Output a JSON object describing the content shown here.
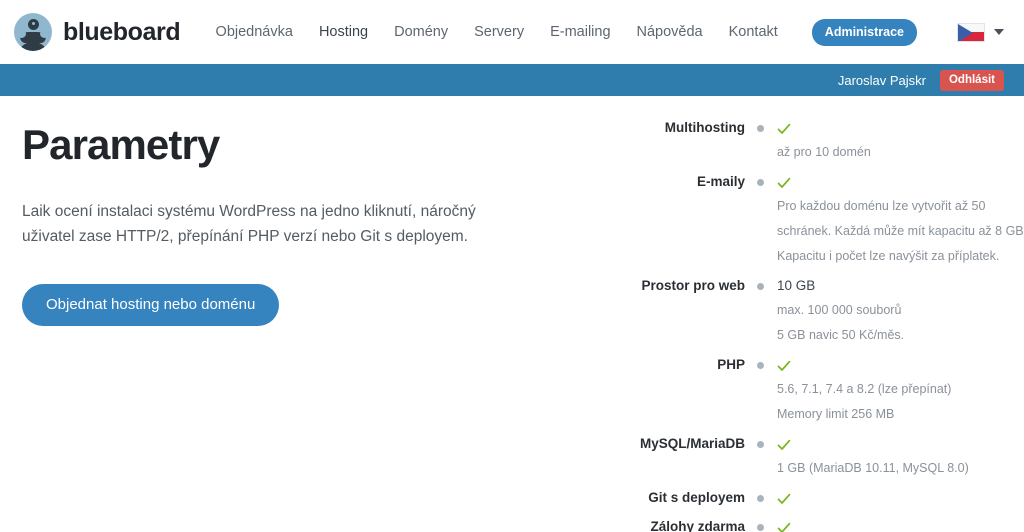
{
  "brand": {
    "name": "blueboard",
    "avatar_icon": "mustache-avatar-icon"
  },
  "nav": {
    "items": [
      {
        "label": "Objednávka",
        "active": false
      },
      {
        "label": "Hosting",
        "active": true
      },
      {
        "label": "Domény",
        "active": false
      },
      {
        "label": "Servery",
        "active": false
      },
      {
        "label": "E-mailing",
        "active": false
      },
      {
        "label": "Nápověda",
        "active": false
      },
      {
        "label": "Kontakt",
        "active": false
      }
    ],
    "admin_button": "Administrace",
    "language_flag": "czech-flag-icon",
    "language_caret": "chevron-down-icon"
  },
  "userbar": {
    "user_name": "Jaroslav Pajskr",
    "logout_label": "Odhlásit"
  },
  "intro": {
    "title": "Parametry",
    "lead": "Laik ocení instalaci systému WordPress na jedno kliknutí, náročný uživatel zase HTTP/2, přepínání PHP verzí nebo Git s deployem.",
    "cta_label": "Objednat hosting nebo doménu"
  },
  "colors": {
    "accent_blue": "#3583bf",
    "userbar_blue": "#2e7dac",
    "logout_red": "#d9534f",
    "check_green": "#7ab51d",
    "dot_gray": "#aab2ba",
    "note_gray": "#8a9199"
  },
  "params": [
    {
      "label": "Multihosting",
      "value_type": "check",
      "value": "",
      "notes": [
        "až pro 10 domén"
      ]
    },
    {
      "label": "E-maily",
      "value_type": "check",
      "value": "",
      "notes": [
        "Pro každou doménu lze vytvořit až 50",
        "schránek. Každá může mít kapacitu až 8 GB.",
        "Kapacitu i počet lze navýšit za příplatek."
      ]
    },
    {
      "label": "Prostor pro web",
      "value_type": "text",
      "value": "10 GB",
      "notes": [
        "max. 100 000 souborů",
        "5 GB navic 50 Kč/měs."
      ]
    },
    {
      "label": "PHP",
      "value_type": "check",
      "value": "",
      "notes": [
        "5.6, 7.1, 7.4 a 8.2 (lze přepínat)",
        "Memory limit 256 MB"
      ]
    },
    {
      "label": "MySQL/MariaDB",
      "value_type": "check",
      "value": "",
      "notes": [
        "1 GB (MariaDB 10.11, MySQL 8.0)"
      ]
    },
    {
      "label": "Git s deployem",
      "value_type": "check",
      "value": "",
      "notes": []
    },
    {
      "label": "Zálohy zdarma",
      "value_type": "check",
      "value": "",
      "notes": []
    }
  ]
}
